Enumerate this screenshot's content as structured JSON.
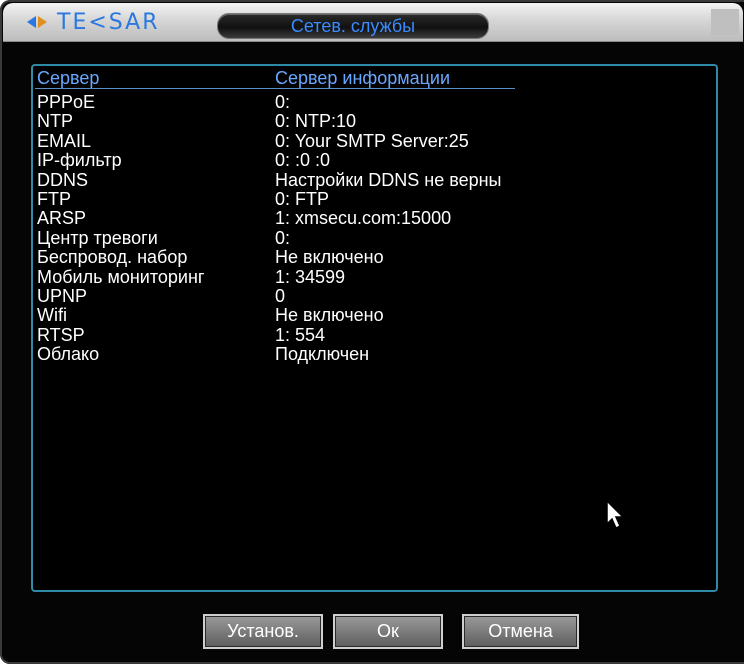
{
  "window": {
    "logo_text": "TE<SAR",
    "title": "Сетев. службы"
  },
  "table": {
    "headers": [
      "Сервер",
      "Сервер информации"
    ],
    "rows": [
      {
        "server": "PPPoE",
        "info": "0:"
      },
      {
        "server": "NTP",
        "info": "0: NTP:10"
      },
      {
        "server": "EMAIL",
        "info": "0: Your SMTP Server:25"
      },
      {
        "server": "IP-фильтр",
        "info": "0: :0 :0"
      },
      {
        "server": "DDNS",
        "info": "Настройки DDNS не верны"
      },
      {
        "server": "FTP",
        "info": "0: FTP"
      },
      {
        "server": "ARSP",
        "info": "1: xmsecu.com:15000"
      },
      {
        "server": "Центр тревоги",
        "info": "0:"
      },
      {
        "server": "Беспровод. набор",
        "info": "Не включено"
      },
      {
        "server": "Мобиль мониторинг",
        "info": "1: 34599"
      },
      {
        "server": "UPNP",
        "info": "0"
      },
      {
        "server": "Wifi",
        "info": "Не включено"
      },
      {
        "server": "RTSP",
        "info": "1: 554"
      },
      {
        "server": "Облако",
        "info": "Подключен"
      }
    ]
  },
  "buttons": {
    "set": "Установ.",
    "ok": "Ок",
    "cancel": "Отмена"
  },
  "icons": {
    "logo": "tesar-logo-icon",
    "cursor": "mouse-pointer-icon"
  },
  "colors": {
    "header_text": "#6aa8ff",
    "body_text": "#ffffff",
    "panel_border": "#2f8aa8",
    "title_text": "#3a8cff"
  }
}
